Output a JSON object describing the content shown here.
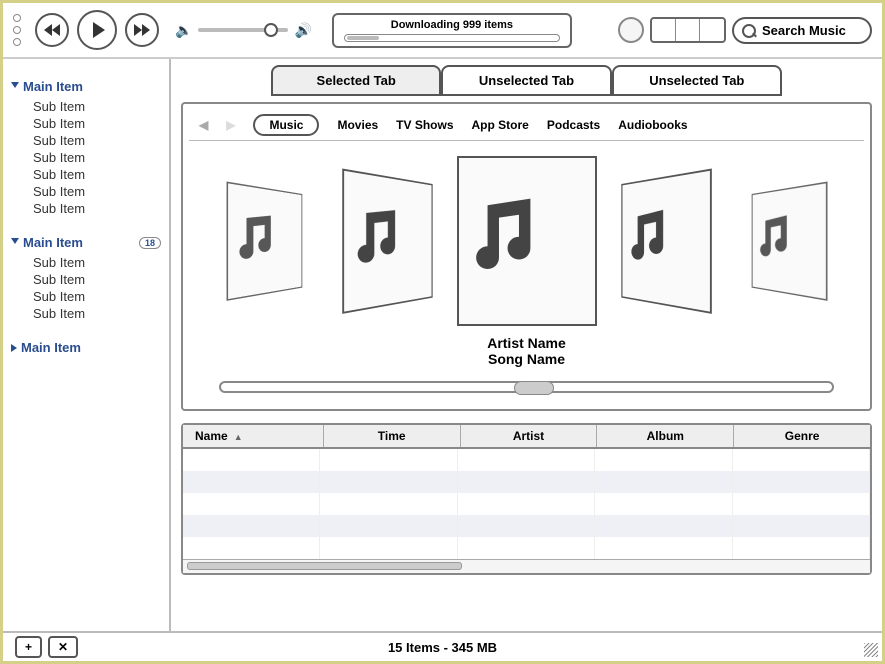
{
  "toolbar": {
    "download_text": "Downloading  999 items",
    "search_placeholder": "Search Music"
  },
  "sidebar": {
    "groups": [
      {
        "label": "Main Item",
        "expanded": true,
        "badge": null,
        "items": [
          "Sub Item",
          "Sub Item",
          "Sub Item",
          "Sub Item",
          "Sub Item",
          "Sub Item",
          "Sub Item"
        ]
      },
      {
        "label": "Main Item",
        "expanded": true,
        "badge": "18",
        "items": [
          "Sub Item",
          "Sub Item",
          "Sub Item",
          "Sub Item"
        ]
      },
      {
        "label": "Main Item",
        "expanded": false,
        "badge": null,
        "items": []
      }
    ]
  },
  "tabs": [
    "Selected Tab",
    "Unselected Tab",
    "Unselected Tab"
  ],
  "nav": {
    "items": [
      "Music",
      "Movies",
      "TV Shows",
      "App Store",
      "Podcasts",
      "Audiobooks"
    ],
    "selected": 0
  },
  "now_playing": {
    "artist": "Artist Name",
    "song": "Song Name"
  },
  "table": {
    "columns": [
      "Name",
      "Time",
      "Artist",
      "Album",
      "Genre"
    ]
  },
  "statusbar": {
    "summary": "15 Items - 345 MB",
    "shuffle": "✕"
  }
}
